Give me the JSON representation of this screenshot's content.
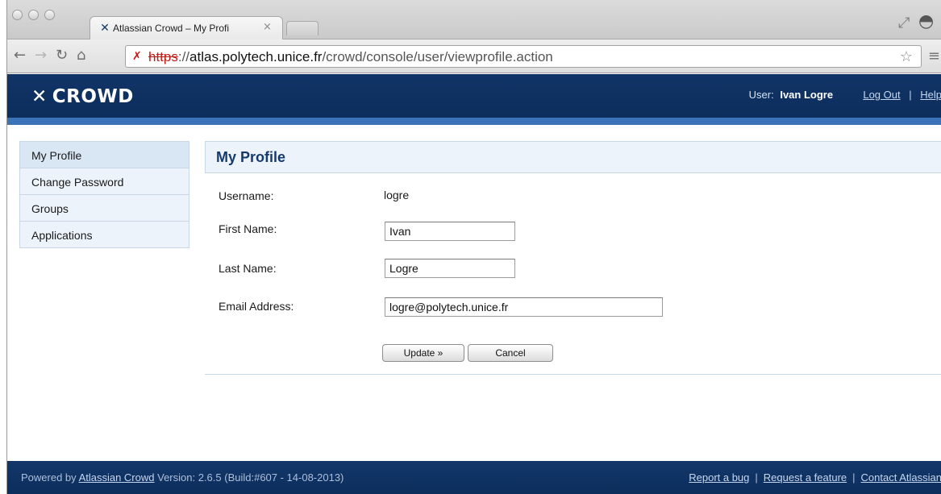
{
  "browser": {
    "tab_title": "Atlassian Crowd – My Profi",
    "tab_close": "×",
    "url_scheme": "https",
    "url_sep": "://",
    "url_host": "atlas.polytech.unice.fr",
    "url_path": "/crowd/console/user/viewprofile.action"
  },
  "header": {
    "logo_mark": "✕",
    "logo_text": "CROWD",
    "user_label": "User:",
    "user_name": "Ivan Logre",
    "logout": "Log Out",
    "separator": "|",
    "help": "Help"
  },
  "sidebar": {
    "items": [
      {
        "label": "My Profile"
      },
      {
        "label": "Change Password"
      },
      {
        "label": "Groups"
      },
      {
        "label": "Applications"
      }
    ]
  },
  "main": {
    "title": "My Profile",
    "username_label": "Username:",
    "username_value": "logre",
    "first_name_label": "First Name:",
    "first_name_value": "Ivan",
    "last_name_label": "Last Name:",
    "last_name_value": "Logre",
    "email_label": "Email Address:",
    "email_value": "logre@polytech.unice.fr",
    "update_button": "Update »",
    "cancel_button": "Cancel"
  },
  "footer": {
    "powered_by": "Powered by",
    "product_link": "Atlassian Crowd",
    "version": "Version: 2.6.5 (Build:#607 - 14-08-2013)",
    "report_bug": "Report a bug",
    "request_feature": "Request a feature",
    "contact": "Contact Atlassian",
    "separator": "|"
  },
  "colors": {
    "header_bg": "#0c2e5d",
    "accent_stripe": "#3b73b9",
    "panel_bg": "#edf3fa",
    "title_text": "#153a6e"
  },
  "icons": [
    "back-icon",
    "forward-icon",
    "reload-icon",
    "home-icon",
    "insecure-lock-icon",
    "bookmark-star-icon",
    "menu-icon",
    "fullscreen-icon",
    "incognito-icon",
    "crowd-logo-icon"
  ]
}
